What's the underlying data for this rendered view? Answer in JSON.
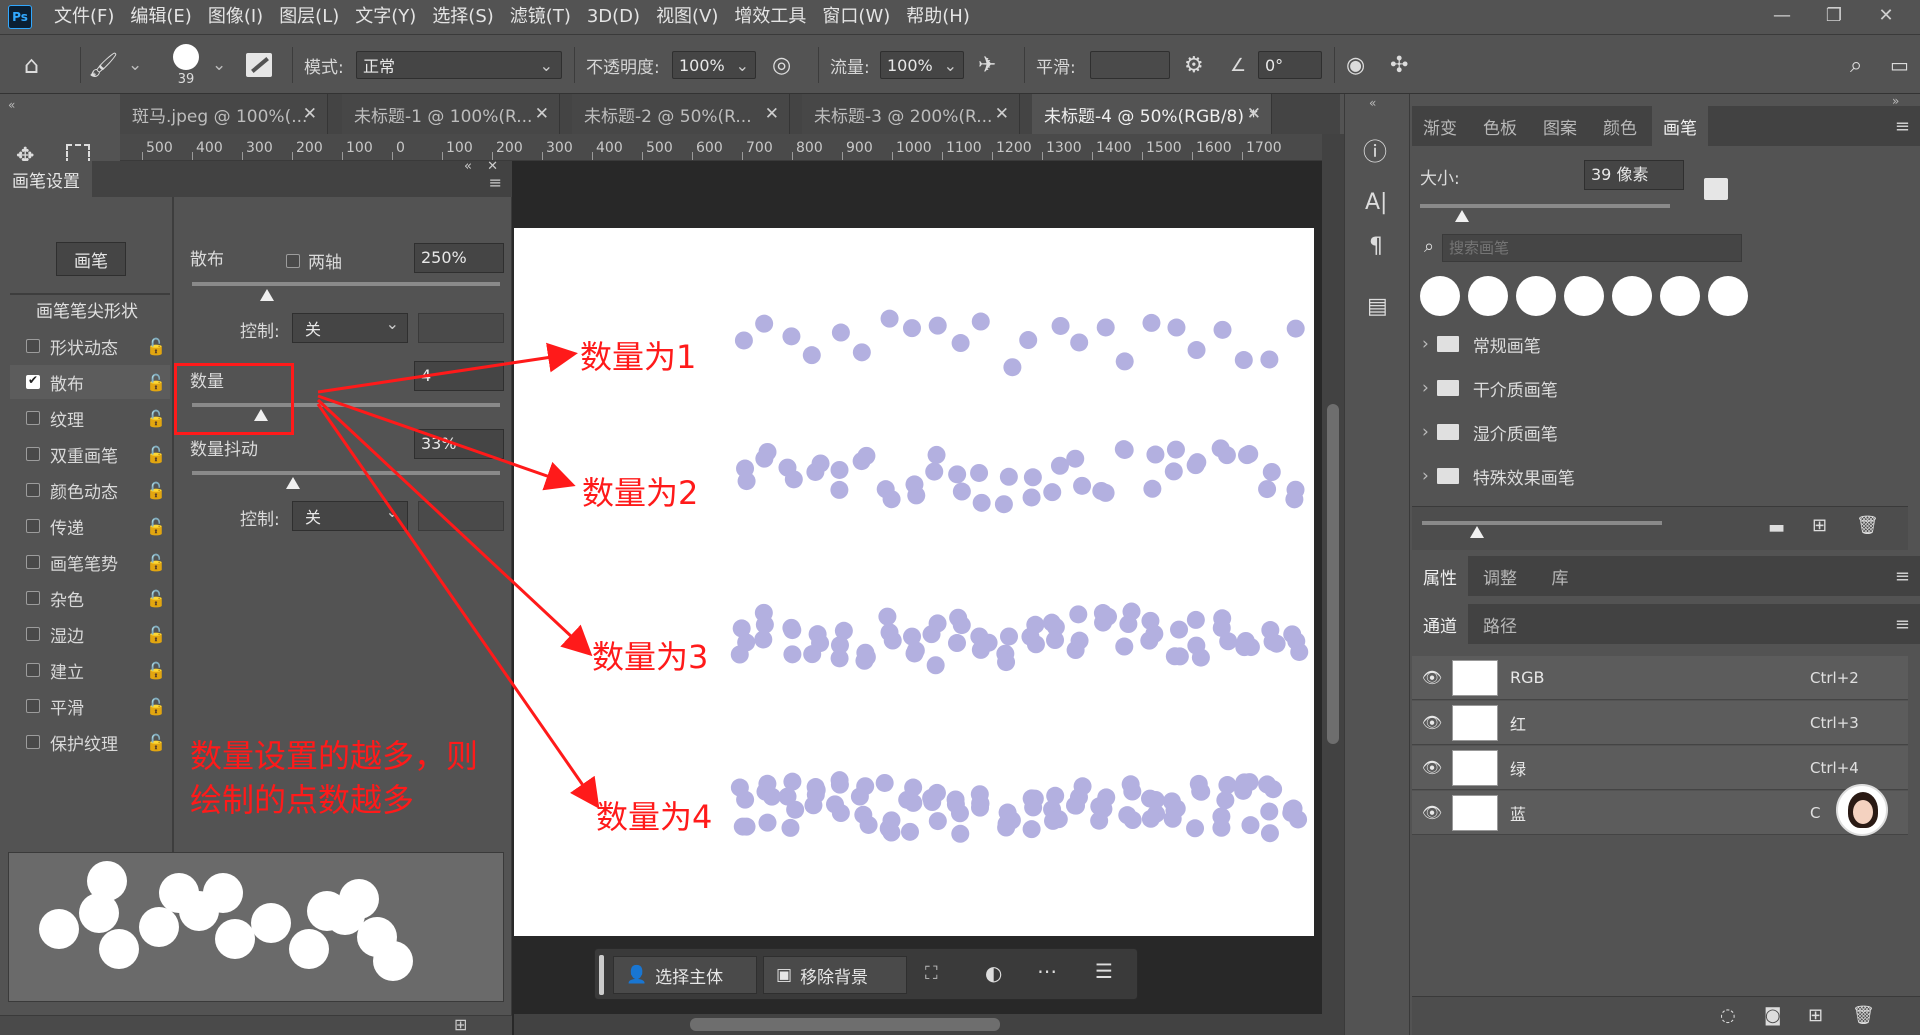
{
  "app": {
    "logo": "Ps"
  },
  "menu": [
    "文件(F)",
    "编辑(E)",
    "图像(I)",
    "图层(L)",
    "文字(Y)",
    "选择(S)",
    "滤镜(T)",
    "3D(D)",
    "视图(V)",
    "增效工具",
    "窗口(W)",
    "帮助(H)"
  ],
  "options": {
    "brush_size": "39",
    "mode_label": "模式:",
    "mode_value": "正常",
    "opacity_label": "不透明度:",
    "opacity_value": "100%",
    "flow_label": "流量:",
    "flow_value": "100%",
    "smooth_label": "平滑:",
    "angle_value": "0°"
  },
  "tabs": [
    {
      "label": "斑马.jpeg @ 100%(...",
      "active": false
    },
    {
      "label": "未标题-1 @ 100%(R...",
      "active": false
    },
    {
      "label": "未标题-2 @ 50%(R...",
      "active": false
    },
    {
      "label": "未标题-3 @ 200%(R...",
      "active": false
    },
    {
      "label": "未标题-4 @ 50%(RGB/8) *",
      "active": true
    }
  ],
  "ruler": [
    "500",
    "400",
    "300",
    "200",
    "100",
    "0",
    "100",
    "200",
    "300",
    "400",
    "500",
    "600",
    "700",
    "800",
    "900",
    "1000",
    "1100",
    "1200",
    "1300",
    "1400",
    "1500",
    "1600",
    "1700"
  ],
  "brush_panel": {
    "title": "画笔设置",
    "brush_button": "画笔",
    "tip_shape": "画笔笔尖形状",
    "items": [
      {
        "label": "形状动态",
        "checked": false
      },
      {
        "label": "散布",
        "checked": true
      },
      {
        "label": "纹理",
        "checked": false
      },
      {
        "label": "双重画笔",
        "checked": false
      },
      {
        "label": "颜色动态",
        "checked": false
      },
      {
        "label": "传递",
        "checked": false
      },
      {
        "label": "画笔笔势",
        "checked": false
      },
      {
        "label": "杂色",
        "checked": false
      },
      {
        "label": "湿边",
        "checked": false
      },
      {
        "label": "建立",
        "checked": false
      },
      {
        "label": "平滑",
        "checked": false
      },
      {
        "label": "保护纹理",
        "checked": false
      }
    ],
    "scatter_label": "散布",
    "both_axes_label": "两轴",
    "scatter_value": "250%",
    "control_label": "控制:",
    "control_value": "关",
    "count_label": "数量",
    "count_value": "4",
    "count_jitter_label": "数量抖动",
    "count_jitter_value": "33%",
    "control2_label": "控制:",
    "control2_value": "关"
  },
  "annotations": {
    "a1": "数量为1",
    "a2": "数量为2",
    "a3": "数量为3",
    "a4": "数量为4",
    "note_line1": "数量设置的越多，则",
    "note_line2": "绘制的点数越多",
    "color": "#ff1a1a"
  },
  "dot_color": "#b3b0e0",
  "brushes_panel": {
    "tabs": [
      "渐变",
      "色板",
      "图案",
      "颜色",
      "画笔"
    ],
    "size_label": "大小:",
    "size_value": "39 像素",
    "search_placeholder": "搜索画笔",
    "folders": [
      "常规画笔",
      "干介质画笔",
      "湿介质画笔",
      "特殊效果画笔"
    ]
  },
  "props_panel": {
    "tabs": [
      "属性",
      "调整",
      "库"
    ]
  },
  "channels_panel": {
    "tabs": [
      "通道",
      "路径"
    ],
    "channels": [
      {
        "name": "RGB",
        "key": "Ctrl+2"
      },
      {
        "name": "红",
        "key": "Ctrl+3"
      },
      {
        "name": "绿",
        "key": "Ctrl+4"
      },
      {
        "name": "蓝",
        "key": "C"
      }
    ]
  },
  "context_bar": {
    "select_subject": "选择主体",
    "remove_bg": "移除背景"
  }
}
